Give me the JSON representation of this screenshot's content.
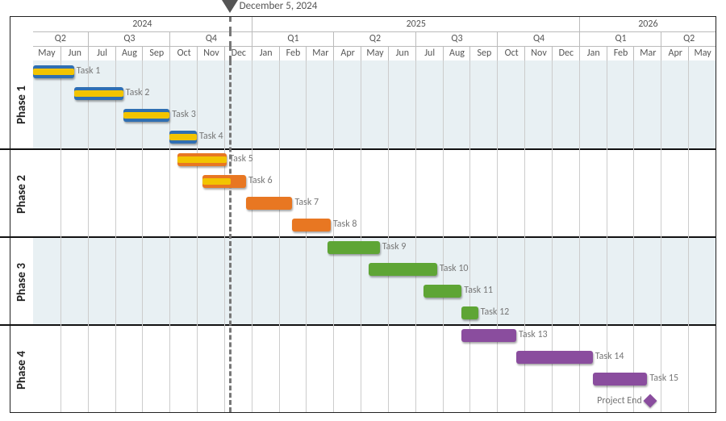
{
  "marker": {
    "date": "December 5, 2024",
    "monthIndex": 7.2
  },
  "timeline": {
    "startMonthIndex": 0,
    "months": [
      "May",
      "Jun",
      "Jul",
      "Aug",
      "Sep",
      "Oct",
      "Nov",
      "Dec",
      "Jan",
      "Feb",
      "Mar",
      "Apr",
      "May",
      "Jun",
      "Jul",
      "Aug",
      "Sep",
      "Oct",
      "Nov",
      "Dec",
      "Jan",
      "Feb",
      "Mar",
      "Apr",
      "May"
    ],
    "quarters": [
      {
        "label": "Q2",
        "start": 0,
        "span": 2
      },
      {
        "label": "Q3",
        "start": 2,
        "span": 3
      },
      {
        "label": "Q4",
        "start": 5,
        "span": 3
      },
      {
        "label": "Q1",
        "start": 8,
        "span": 3
      },
      {
        "label": "Q2",
        "start": 11,
        "span": 3
      },
      {
        "label": "Q3",
        "start": 14,
        "span": 3
      },
      {
        "label": "Q4",
        "start": 17,
        "span": 3
      },
      {
        "label": "Q1",
        "start": 20,
        "span": 3
      },
      {
        "label": "Q2",
        "start": 23,
        "span": 2
      }
    ],
    "years": [
      {
        "label": "2024",
        "start": 0,
        "span": 8
      },
      {
        "label": "2025",
        "start": 8,
        "span": 12
      },
      {
        "label": "2026",
        "start": 20,
        "span": 5
      }
    ]
  },
  "phases": [
    {
      "name": "Phase 1",
      "rows": 4,
      "shade": true
    },
    {
      "name": "Phase 2",
      "rows": 4,
      "shade": false
    },
    {
      "name": "Phase 3",
      "rows": 4,
      "shade": true
    },
    {
      "name": "Phase 4",
      "rows": 4,
      "shade": false
    }
  ],
  "colors": {
    "phase1": "#2f6fb3",
    "phase1Prog": "#f2c400",
    "phase2": "#e87722",
    "phase2Prog": "#f2c400",
    "phase3": "#5ea535",
    "phase4": "#8a4d9e",
    "milestone": "#8a4d9e"
  },
  "tasks": [
    {
      "label": "Task 1",
      "row": 0,
      "start": 0.0,
      "dur": 1.5,
      "fill": "phase1",
      "progress": 1.0
    },
    {
      "label": "Task 2",
      "row": 1,
      "start": 1.5,
      "dur": 1.8,
      "fill": "phase1",
      "progress": 1.0
    },
    {
      "label": "Task 3",
      "row": 2,
      "start": 3.3,
      "dur": 1.7,
      "fill": "phase1",
      "progress": 1.0
    },
    {
      "label": "Task 4",
      "row": 3,
      "start": 5.0,
      "dur": 1.0,
      "fill": "phase1",
      "progress": 1.0
    },
    {
      "label": "Task 5",
      "row": 4,
      "start": 5.3,
      "dur": 1.8,
      "fill": "phase2",
      "progress": 1.0
    },
    {
      "label": "Task 6",
      "row": 5,
      "start": 6.2,
      "dur": 1.6,
      "fill": "phase2",
      "progress": 0.65
    },
    {
      "label": "Task 7",
      "row": 6,
      "start": 7.8,
      "dur": 1.7,
      "fill": "phase2",
      "progress": 0.0
    },
    {
      "label": "Task 8",
      "row": 7,
      "start": 9.5,
      "dur": 1.4,
      "fill": "phase2",
      "progress": 0.0
    },
    {
      "label": "Task 9",
      "row": 8,
      "start": 10.8,
      "dur": 1.9,
      "fill": "phase3",
      "progress": 0.0
    },
    {
      "label": "Task 10",
      "row": 9,
      "start": 12.3,
      "dur": 2.5,
      "fill": "phase3",
      "progress": 0.0
    },
    {
      "label": "Task 11",
      "row": 10,
      "start": 14.3,
      "dur": 1.4,
      "fill": "phase3",
      "progress": 0.0
    },
    {
      "label": "Task 12",
      "row": 11,
      "start": 15.7,
      "dur": 0.6,
      "fill": "phase3",
      "progress": 0.0
    },
    {
      "label": "Task 13",
      "row": 12,
      "start": 15.7,
      "dur": 2.0,
      "fill": "phase4",
      "progress": 0.0
    },
    {
      "label": "Task 14",
      "row": 13,
      "start": 17.7,
      "dur": 2.8,
      "fill": "phase4",
      "progress": 0.0
    },
    {
      "label": "Task 15",
      "row": 14,
      "start": 20.5,
      "dur": 2.0,
      "fill": "phase4",
      "progress": 0.0
    }
  ],
  "milestones": [
    {
      "label": "Project End",
      "row": 15,
      "at": 22.6,
      "fill": "milestone"
    }
  ],
  "chart_data": {
    "type": "gantt",
    "title": "",
    "today_marker": "2024-12-05",
    "x_axis": {
      "unit": "month",
      "start": "2024-05",
      "end": "2026-05"
    },
    "phases": [
      "Phase 1",
      "Phase 2",
      "Phase 3",
      "Phase 4"
    ],
    "tasks": [
      {
        "phase": "Phase 1",
        "name": "Task 1",
        "start": "2024-05",
        "end": "2024-06",
        "progress": 1.0
      },
      {
        "phase": "Phase 1",
        "name": "Task 2",
        "start": "2024-06",
        "end": "2024-08",
        "progress": 1.0
      },
      {
        "phase": "Phase 1",
        "name": "Task 3",
        "start": "2024-08",
        "end": "2024-10",
        "progress": 1.0
      },
      {
        "phase": "Phase 1",
        "name": "Task 4",
        "start": "2024-10",
        "end": "2024-11",
        "progress": 1.0
      },
      {
        "phase": "Phase 2",
        "name": "Task 5",
        "start": "2024-10",
        "end": "2024-12",
        "progress": 1.0
      },
      {
        "phase": "Phase 2",
        "name": "Task 6",
        "start": "2024-11",
        "end": "2025-01",
        "progress": 0.65
      },
      {
        "phase": "Phase 2",
        "name": "Task 7",
        "start": "2025-01",
        "end": "2025-02",
        "progress": 0.0
      },
      {
        "phase": "Phase 2",
        "name": "Task 8",
        "start": "2025-02",
        "end": "2025-04",
        "progress": 0.0
      },
      {
        "phase": "Phase 3",
        "name": "Task 9",
        "start": "2025-04",
        "end": "2025-06",
        "progress": 0.0
      },
      {
        "phase": "Phase 3",
        "name": "Task 10",
        "start": "2025-05",
        "end": "2025-08",
        "progress": 0.0
      },
      {
        "phase": "Phase 3",
        "name": "Task 11",
        "start": "2025-07",
        "end": "2025-09",
        "progress": 0.0
      },
      {
        "phase": "Phase 3",
        "name": "Task 12",
        "start": "2025-09",
        "end": "2025-09",
        "progress": 0.0
      },
      {
        "phase": "Phase 4",
        "name": "Task 13",
        "start": "2025-09",
        "end": "2025-11",
        "progress": 0.0
      },
      {
        "phase": "Phase 4",
        "name": "Task 14",
        "start": "2025-11",
        "end": "2026-01",
        "progress": 0.0
      },
      {
        "phase": "Phase 4",
        "name": "Task 15",
        "start": "2026-01",
        "end": "2026-03",
        "progress": 0.0
      }
    ],
    "milestones": [
      {
        "name": "Project End",
        "date": "2026-03"
      }
    ]
  }
}
